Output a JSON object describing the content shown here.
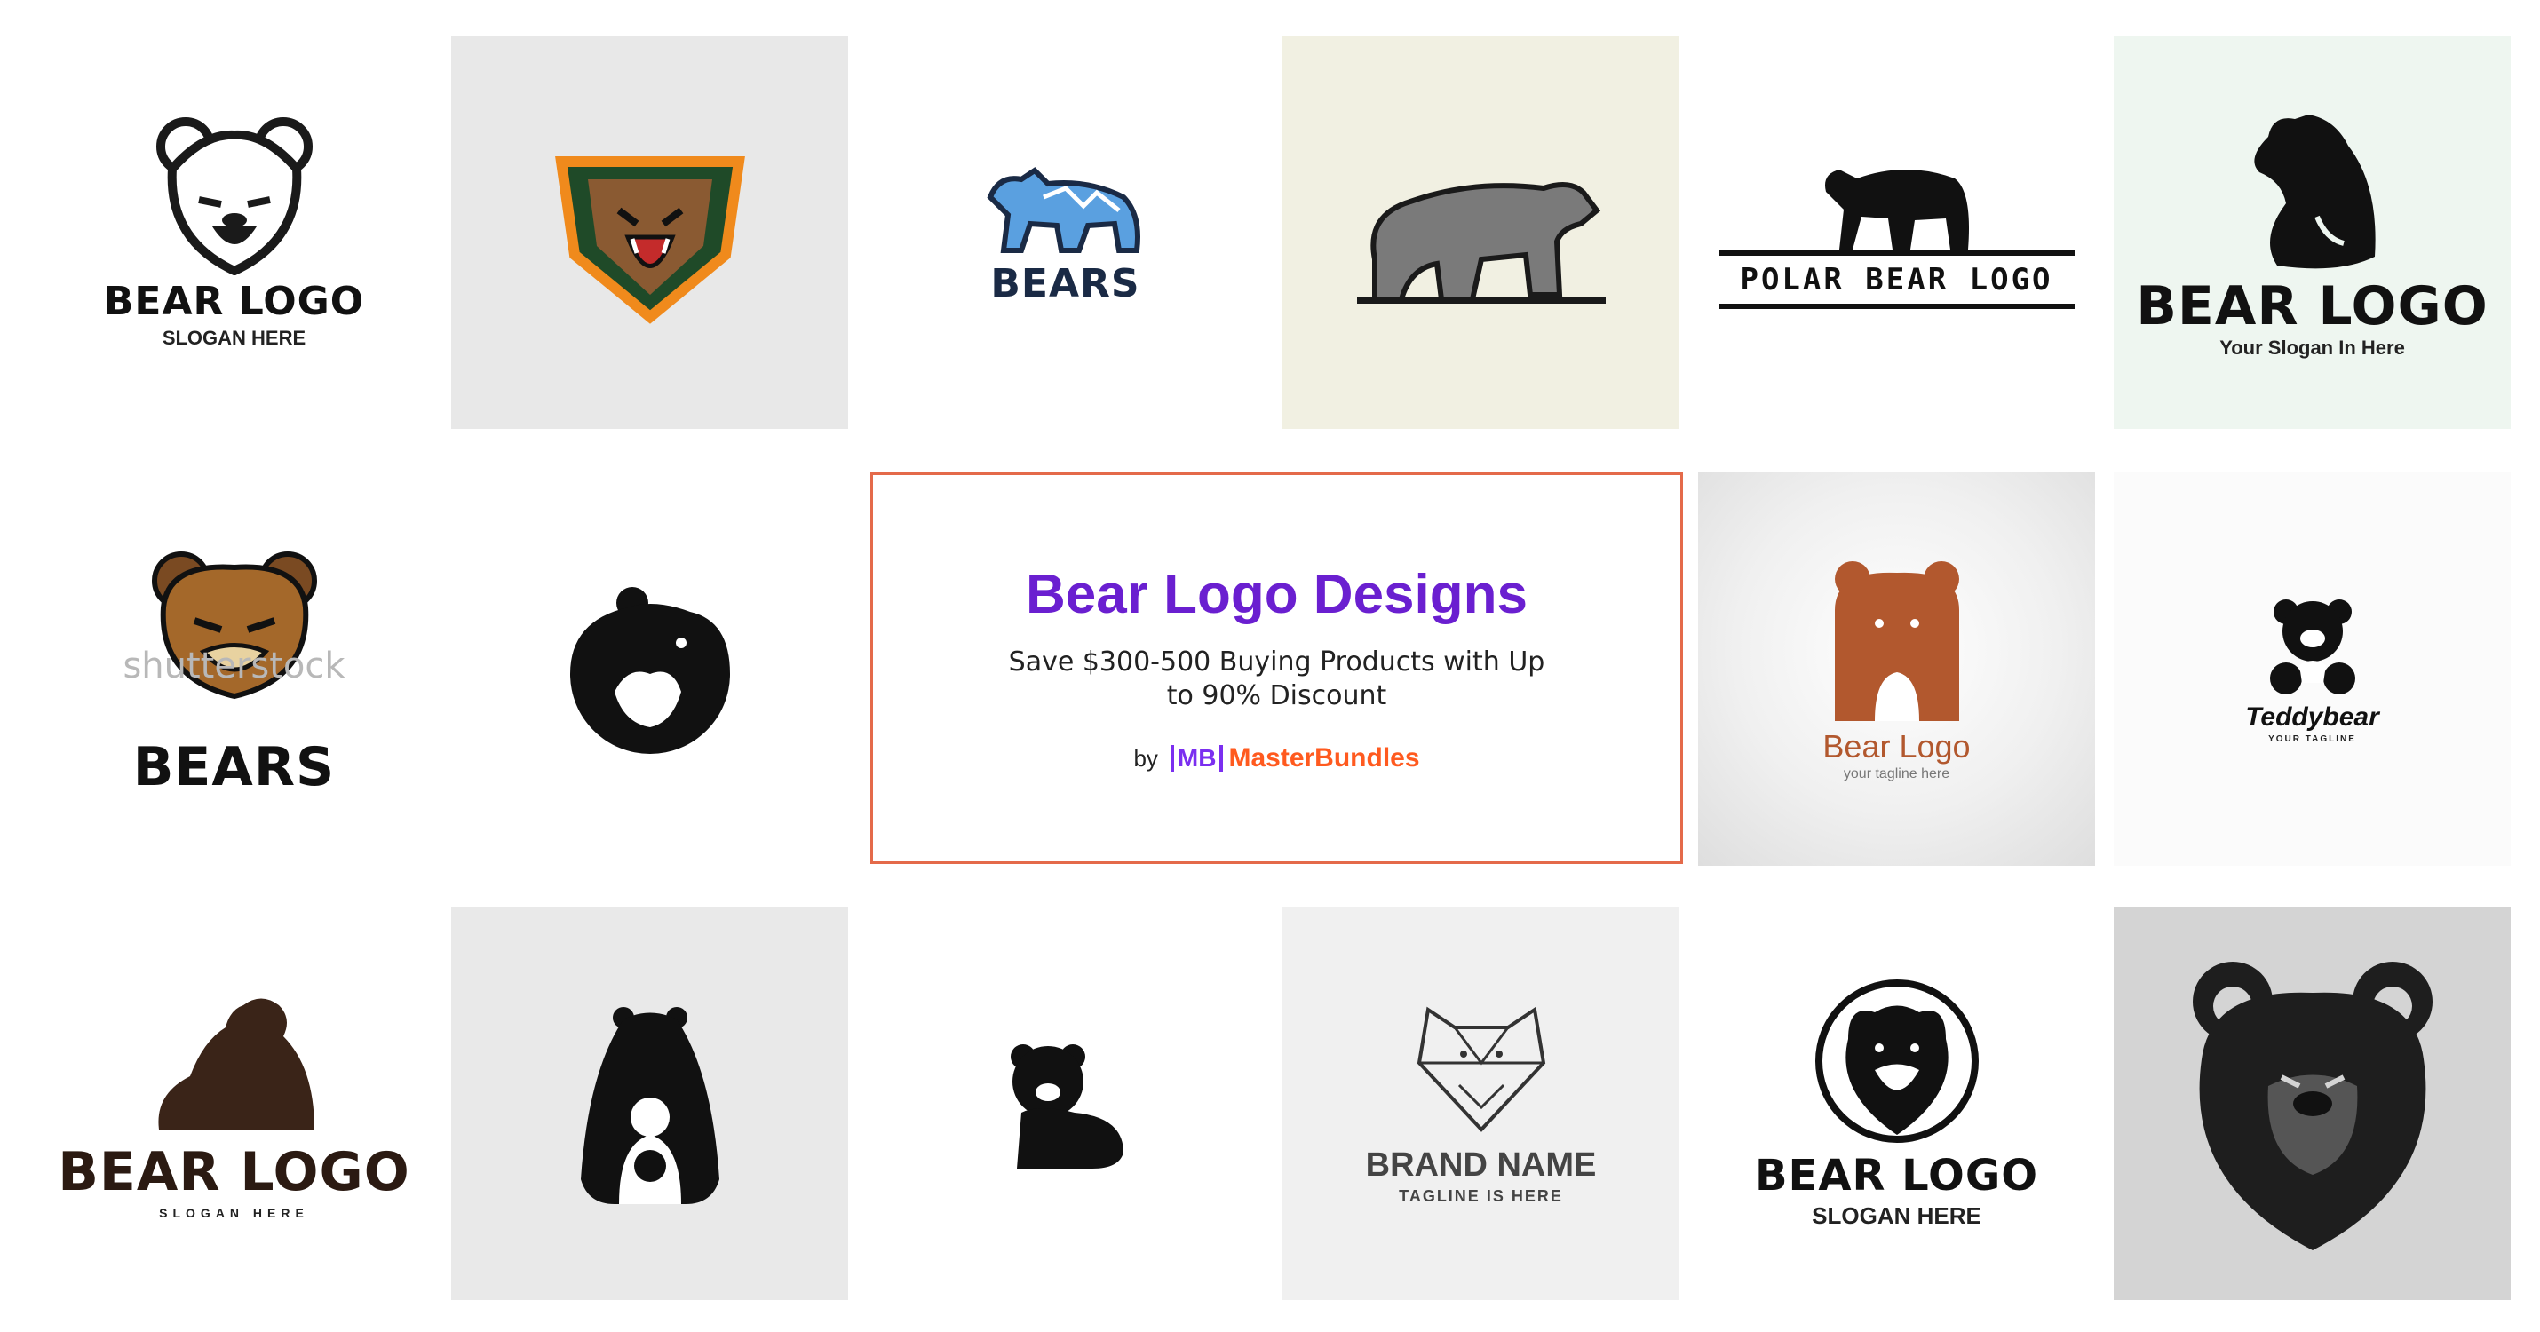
{
  "promo": {
    "title": "Bear Logo Designs",
    "subtitle": "Save $300-500 Buying Products with Up to 90% Discount",
    "by_label": "by",
    "brand_mark": "MB",
    "brand_name": "MasterBundles",
    "accent_color": "#6a1fd0",
    "border_color": "#e46a4a"
  },
  "tiles": {
    "t1": {
      "title": "BEAR LOGO",
      "sub": "SLOGAN HERE"
    },
    "t2": {},
    "t3": {
      "title": "BEARS"
    },
    "t4": {},
    "t5": {
      "title": "POLAR BEAR LOGO"
    },
    "t6": {
      "title": "BEAR LOGO",
      "sub": "Your Slogan In Here"
    },
    "t7": {
      "title": "BEARS",
      "watermark": "shutterstock"
    },
    "t8": {},
    "t9": {
      "title": "Bear Logo",
      "sub": "your tagline here"
    },
    "t10": {
      "title": "Teddybear",
      "sub": "YOUR TAGLINE"
    },
    "t11": {
      "title": "BEAR LOGO",
      "sub": "SLOGAN HERE"
    },
    "t12": {},
    "t13": {},
    "t14": {
      "title": "BRAND NAME",
      "sub": "TAGLINE IS HERE"
    },
    "t15": {
      "title": "BEAR LOGO",
      "sub": "SLOGAN HERE"
    },
    "t16": {}
  }
}
